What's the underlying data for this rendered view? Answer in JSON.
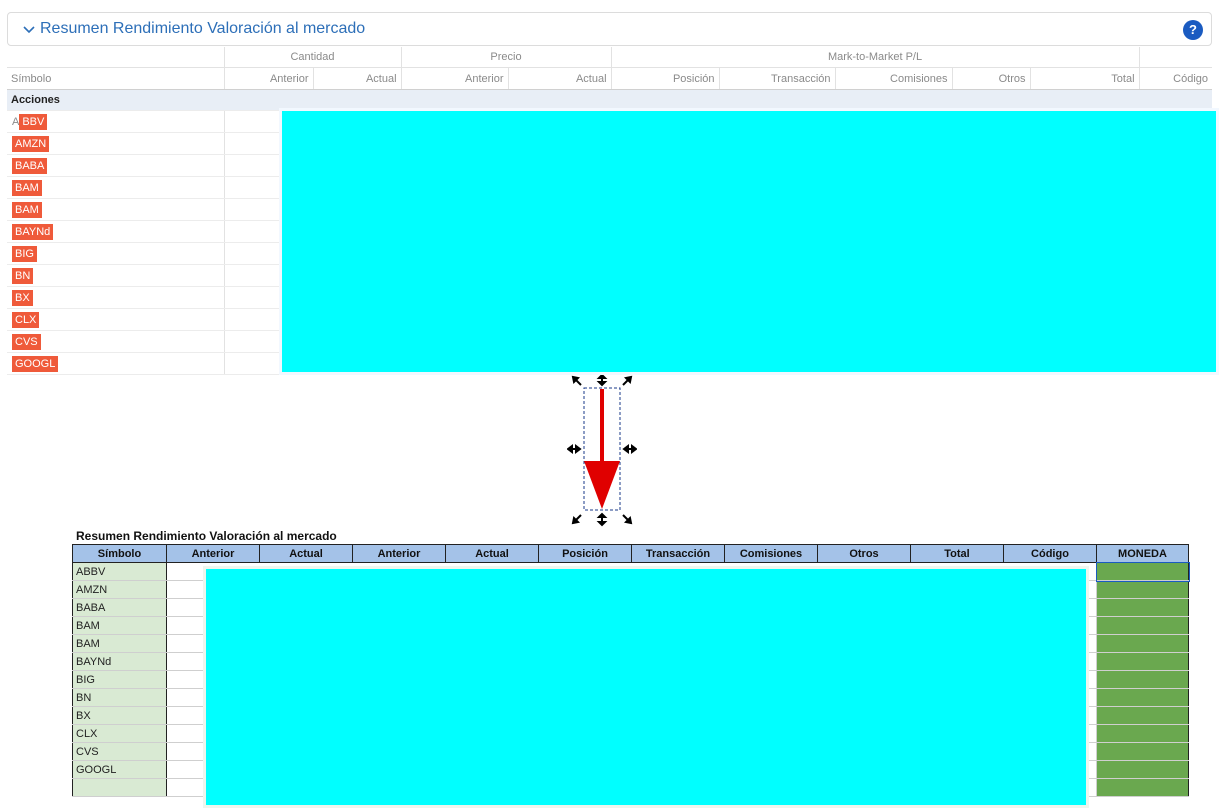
{
  "top_panel": {
    "title": "Resumen Rendimiento Valoración al mercado",
    "help_label": "?",
    "group_headers": [
      "",
      "Cantidad",
      "Precio",
      "Mark-to-Market P/L",
      ""
    ],
    "columns": [
      "Símbolo",
      "Anterior",
      "Actual",
      "Anterior",
      "Actual",
      "Posición",
      "Transacción",
      "Comisiones",
      "Otros",
      "Total",
      "Código"
    ],
    "section": "Acciones",
    "first_symbol_prefix": "A",
    "first_symbol_tag": "BBV",
    "symbols": [
      "AMZN",
      "BABA",
      "BAM",
      "BAM",
      "BAYNd",
      "BIG",
      "BN",
      "BX",
      "CLX",
      "CVS",
      "GOOGL"
    ]
  },
  "spreadsheet": {
    "title": "Resumen Rendimiento Valoración al mercado",
    "columns": [
      "Símbolo",
      "Anterior",
      "Actual",
      "Anterior",
      "Actual",
      "Posición",
      "Transacción",
      "Comisiones",
      "Otros",
      "Total",
      "Código",
      "MONEDA"
    ],
    "symbols": [
      "ABBV",
      "AMZN",
      "BABA",
      "BAM",
      "BAM",
      "BAYNd",
      "BIG",
      "BN",
      "BX",
      "CLX",
      "CVS",
      "GOOGL"
    ]
  },
  "colors": {
    "link_blue": "#2d6fb8",
    "tag_red": "#ef5a3a",
    "redaction_cyan": "#00ffff",
    "arrow_red": "#e00000",
    "header_blue": "#a4c2e8",
    "symbol_green": "#d9ead3",
    "moneda_green": "#6aa84f"
  }
}
